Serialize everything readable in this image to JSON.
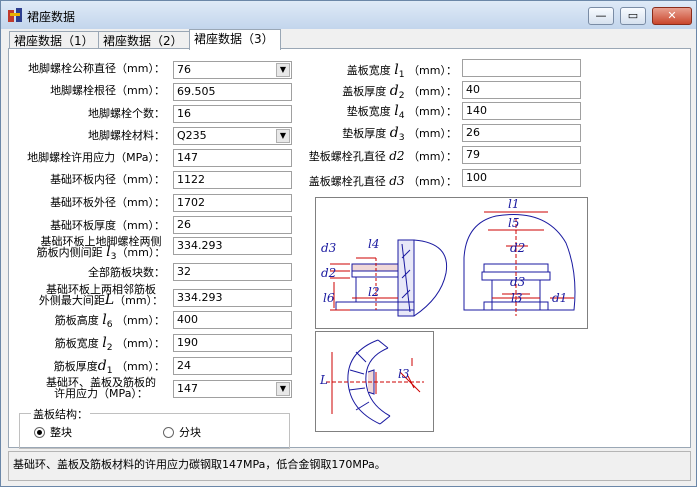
{
  "window": {
    "title": "裙座数据",
    "minimize": "—",
    "maximize": "▭",
    "close": "✕"
  },
  "tabs": [
    "裙座数据（1）",
    "裙座数据（2）",
    "裙座数据（3）"
  ],
  "left": {
    "bolt_diameter": {
      "label": "地脚螺栓公称直径（mm）：",
      "value": "76"
    },
    "bolt_root_dia": {
      "label": "地脚螺栓根径（mm）：",
      "value": "69.505"
    },
    "bolt_count": {
      "label": "地脚螺栓个数：",
      "value": "16"
    },
    "bolt_material": {
      "label": "地脚螺栓材料：",
      "value": "Q235"
    },
    "bolt_allow_stress": {
      "label": "地脚螺栓许用应力（MPa）：",
      "value": "147"
    },
    "ring_inner": {
      "label": "基础环板内径（mm）：",
      "value": "1122"
    },
    "ring_outer": {
      "label": "基础环板外径（mm）：",
      "value": "1702"
    },
    "ring_thick": {
      "label": "基础环板厚度（mm）：",
      "value": "26"
    },
    "bolt_gap_1": "基础环板上地脚螺栓两侧",
    "bolt_gap_2": "筋板内侧间距",
    "bolt_gap_sym": "l",
    "bolt_gap_sub": "3",
    "bolt_gap_unit": "（mm）：",
    "bolt_gap_value": "334.293",
    "rib_count": {
      "label": "全部筋板块数：",
      "value": "32"
    },
    "rib_gap_1": "基础环板上两相邻筋板",
    "rib_gap_2": "外侧最大间距",
    "rib_gap_sym": "L",
    "rib_gap_unit": "（mm）：",
    "rib_gap_value": "334.293",
    "rib_height_text": "筋板高度",
    "rib_height_sym": "l",
    "rib_height_sub": "6",
    "rib_height_unit": "（mm）：",
    "rib_height_value": "400",
    "rib_width_text": "筋板宽度",
    "rib_width_sym": "l",
    "rib_width_sub": "2",
    "rib_width_unit": "（mm）：",
    "rib_width_value": "190",
    "rib_thick_text": "筋板厚度",
    "rib_thick_sym": "d",
    "rib_thick_sub": "1",
    "rib_thick_unit": "（mm）：",
    "rib_thick_value": "24",
    "allow_1": "基础环、盖板及筋板的",
    "allow_2": "许用应力（MPa）：",
    "allow_value": "147"
  },
  "cover_group": {
    "title": "盖板结构：",
    "opt1": "整块",
    "opt2": "分块"
  },
  "right": {
    "cover_width_text": "盖板宽度",
    "cover_width_sym": "l",
    "cover_width_sub": "1",
    "cover_width_unit": "（mm）：",
    "cover_width_value": "",
    "cover_thick_text": "盖板厚度",
    "cover_thick_sym": "d",
    "cover_thick_sub": "2",
    "cover_thick_unit": "（mm）：",
    "cover_thick_value": "40",
    "pad_width_text": "垫板宽度",
    "pad_width_sym": "l",
    "pad_width_sub": "4",
    "pad_width_unit": "（mm）：",
    "pad_width_value": "140",
    "pad_thick_text": "垫板厚度",
    "pad_thick_sym": "d",
    "pad_thick_sub": "3",
    "pad_thick_unit": "（mm）：",
    "pad_thick_value": "26",
    "pad_hole_text": "垫板螺栓孔直径",
    "pad_hole_sym": "d2",
    "pad_hole_unit": "（mm）：",
    "pad_hole_value": "79",
    "cover_hole_text": "盖板螺栓孔直径",
    "cover_hole_sym": "d3",
    "cover_hole_unit": "（mm）：",
    "cover_hole_value": "100"
  },
  "diagram_labels": {
    "d3": "d3",
    "d2": "d2",
    "l4": "l4",
    "l6": "l6",
    "l2": "l2",
    "l1": "l1",
    "l5": "l5",
    "l3": "l3",
    "d1": "d1",
    "L": "L"
  },
  "status": "基础环、盖板及筋板材料的许用应力碳钢取147MPa，低合金钢取170MPa。"
}
